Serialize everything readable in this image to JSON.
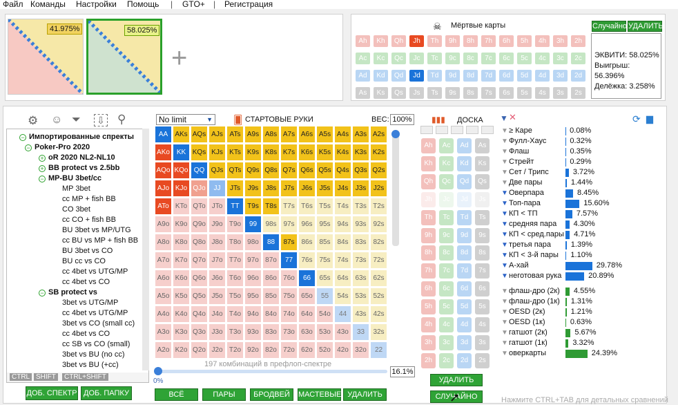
{
  "menu": [
    "Файл",
    "Команды",
    "Настройки",
    "Помощь",
    "GTO+",
    "Регистрация"
  ],
  "ranges": {
    "left_pct": "41.975%",
    "right_pct": "58.025%"
  },
  "dead": {
    "title": "Мёртвые карты",
    "random": "Случайно",
    "delete": "УДАЛИТЬ",
    "rows": [
      [
        "Ah",
        "Kh",
        "Qh",
        "Jh",
        "Th",
        "9h",
        "8h",
        "7h",
        "6h",
        "5h",
        "4h",
        "3h",
        "2h"
      ],
      [
        "Ac",
        "Kc",
        "Qc",
        "Jc",
        "Tc",
        "9c",
        "8c",
        "7c",
        "6c",
        "5c",
        "4c",
        "3c",
        "2c"
      ],
      [
        "Ad",
        "Kd",
        "Qd",
        "Jd",
        "Td",
        "9d",
        "8d",
        "7d",
        "6d",
        "5d",
        "4d",
        "3d",
        "2d"
      ],
      [
        "As",
        "Ks",
        "Qs",
        "Js",
        "Ts",
        "9s",
        "8s",
        "7s",
        "6s",
        "5s",
        "4s",
        "3s",
        "2s"
      ]
    ],
    "selected": [
      "Jh",
      "Jd"
    ]
  },
  "equity": {
    "equity": "ЭКВИТИ: 58.025%",
    "wins": "Выигрыш: 56.396%",
    "ties": "Делёжка: 3.258%"
  },
  "tree": [
    {
      "t": "Импортированные спректы",
      "l": 0,
      "b": 1,
      "tog": "−"
    },
    {
      "t": "Poker-Pro 2020",
      "l": 1,
      "b": 1,
      "tog": "−"
    },
    {
      "t": "oR 2020 NL2-NL10",
      "l": 2,
      "b": 1,
      "tog": "+"
    },
    {
      "t": "BB protect vs 2.5bb",
      "l": 2,
      "b": 1,
      "tog": "+"
    },
    {
      "t": "MP-BU 3bet/cc",
      "l": 2,
      "b": 1,
      "tog": "−"
    },
    {
      "t": "MP 3bet",
      "l": 3
    },
    {
      "t": "cc MP + fish BB",
      "l": 3
    },
    {
      "t": "CO 3bet",
      "l": 3
    },
    {
      "t": "cc CO + fish BB",
      "l": 3
    },
    {
      "t": "BU 3bet vs MP/UTG",
      "l": 3
    },
    {
      "t": "cc BU vs MP + fish BB",
      "l": 3
    },
    {
      "t": "BU 3bet vs CO",
      "l": 3
    },
    {
      "t": "BU cc vs CO",
      "l": 3
    },
    {
      "t": "cc 4bet vs UTG/MP",
      "l": 3
    },
    {
      "t": "cc 4bet vs CO",
      "l": 3
    },
    {
      "t": "SB protect vs",
      "l": 2,
      "b": 1,
      "tog": "−"
    },
    {
      "t": "3bet vs UTG/MP",
      "l": 3
    },
    {
      "t": "cc 4bet vs UTG/MP",
      "l": 3
    },
    {
      "t": "3bet vs CO (small cc)",
      "l": 3
    },
    {
      "t": "cc 4bet vs CO",
      "l": 3
    },
    {
      "t": "cc SB vs CO (small)",
      "l": 3
    },
    {
      "t": "3bet vs BU (no cc)",
      "l": 3
    },
    {
      "t": "3bet vs BU (+cc)",
      "l": 3
    }
  ],
  "tree_footer": [
    "CTRL",
    "SHIFT",
    "CTRL+SHIFT"
  ],
  "add_spectrum": "ДОБ. СПЕКТР",
  "add_folder": "ДОБ. ПАПКУ",
  "grid": {
    "limit": "No limit",
    "title": "СТАРТОВЫЕ РУКИ",
    "weight_label": "ВЕС:",
    "weight": "100%",
    "combos": "197 комбинаций в префлоп-спектре",
    "slider_left": "0%",
    "slider_right": "16.1%"
  },
  "grid_buttons": [
    "ВСЁ",
    "ПАРЫ",
    "БРОДВЕЙ",
    "МАСТЕВЫЕ",
    "УДАЛИТЬ"
  ],
  "board": {
    "title": "ДОСКА",
    "cols": [
      [
        "Ah",
        "Kh",
        "Qh",
        "Jh",
        "Th",
        "9h",
        "8h",
        "7h",
        "6h",
        "5h",
        "4h",
        "3h",
        "2h"
      ],
      [
        "Ac",
        "Kc",
        "Qc",
        "Jc",
        "Tc",
        "9c",
        "8c",
        "7c",
        "6c",
        "5c",
        "4c",
        "3c",
        "2c"
      ],
      [
        "Ad",
        "Kd",
        "Qd",
        "Jd",
        "Td",
        "9d",
        "8d",
        "7d",
        "6d",
        "5d",
        "4d",
        "3d",
        "2d"
      ],
      [
        "As",
        "Ks",
        "Qs",
        "Js",
        "Ts",
        "9s",
        "8s",
        "7s",
        "6s",
        "5s",
        "4s",
        "3s",
        "2s"
      ]
    ],
    "delete": "УДАЛИТЬ",
    "random": "СЛУЧАЙНО"
  },
  "stats": [
    {
      "n": "≥ Каре",
      "v": "0.08%",
      "p": 0.08
    },
    {
      "n": "Фулл-Хаус",
      "v": "0.32%",
      "p": 0.32
    },
    {
      "n": "Флаш",
      "v": "0.35%",
      "p": 0.35
    },
    {
      "n": "Стрейт",
      "v": "0.29%",
      "p": 0.29
    },
    {
      "n": "Сет / Трипс",
      "v": "3.72%",
      "p": 3.72
    },
    {
      "n": "Две пары",
      "v": "1.44%",
      "p": 1.44
    },
    {
      "n": "Оверпара",
      "v": "8.45%",
      "p": 8.45,
      "f": 1
    },
    {
      "n": "Топ-пара",
      "v": "15.60%",
      "p": 15.6,
      "f": 1
    },
    {
      "n": "КП < ТП",
      "v": "7.57%",
      "p": 7.57,
      "f": 1
    },
    {
      "n": "средняя пара",
      "v": "4.30%",
      "p": 4.3,
      "f": 1
    },
    {
      "n": "КП < сред.пары",
      "v": "4.71%",
      "p": 4.71,
      "f": 1
    },
    {
      "n": "третья пара",
      "v": "1.39%",
      "p": 1.39,
      "f": 1
    },
    {
      "n": "КП < 3-й пары",
      "v": "1.10%",
      "p": 1.1,
      "f": 1
    },
    {
      "n": "А-хай",
      "v": "29.78%",
      "p": 29.78,
      "f": 1
    },
    {
      "n": "неготовая рука",
      "v": "20.89%",
      "p": 20.89,
      "f": 1
    }
  ],
  "draws": [
    {
      "n": "флаш-дро (2к)",
      "v": "4.55%",
      "p": 4.55
    },
    {
      "n": "флаш-дро (1к)",
      "v": "1.31%",
      "p": 1.31
    },
    {
      "n": "OESD (2к)",
      "v": "1.21%",
      "p": 1.21
    },
    {
      "n": "OESD (1к)",
      "v": "0.63%",
      "p": 0.63
    },
    {
      "n": "гатшот (2к)",
      "v": "5.67%",
      "p": 5.67
    },
    {
      "n": "гатшот (1к)",
      "v": "3.32%",
      "p": 3.32
    },
    {
      "n": "оверкарты",
      "v": "24.39%",
      "p": 24.39
    }
  ],
  "hint": "Нажмите CTRL+TAB для детальных сравнений",
  "colors": {
    "pair": "#1a73d9",
    "off": "#f4bcbc",
    "suited": "#f4e49a",
    "sel": "#e84a22",
    "green": "#2f9b34"
  }
}
